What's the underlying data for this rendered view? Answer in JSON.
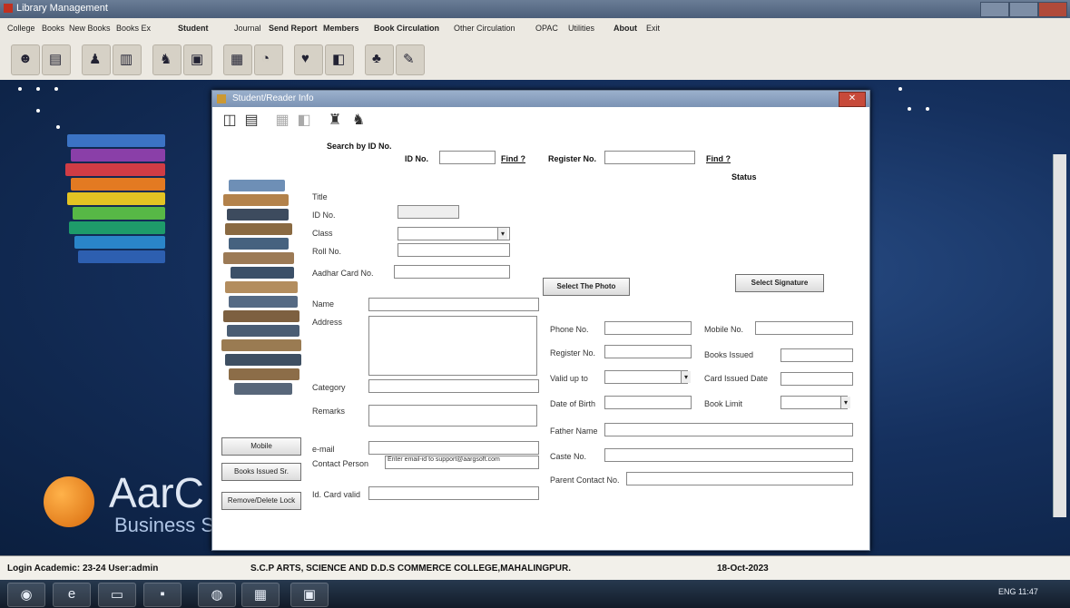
{
  "window": {
    "title": "Library Management"
  },
  "menubar": {
    "items": [
      {
        "label": "College",
        "bold": false
      },
      {
        "label": "Books",
        "bold": false
      },
      {
        "label": "New Books",
        "bold": false
      },
      {
        "label": "Books Ex",
        "bold": false
      },
      {
        "label": "Student",
        "bold": true
      },
      {
        "label": "Journal",
        "bold": false
      },
      {
        "label": "Send Report",
        "bold": true
      },
      {
        "label": "Members",
        "bold": true
      },
      {
        "label": "Book Circulation",
        "bold": true
      },
      {
        "label": "Other Circulation",
        "bold": false
      },
      {
        "label": "OPAC",
        "bold": false
      },
      {
        "label": "Utilities",
        "bold": false
      },
      {
        "label": "About",
        "bold": true
      },
      {
        "label": "Exit",
        "bold": false
      }
    ]
  },
  "toolbar": {
    "icons": [
      "person-icon",
      "monitor-icon",
      "user-icon",
      "books-icon",
      "reader-icon",
      "card-icon",
      "report-icon",
      "chart-icon",
      "people-icon",
      "shelf-icon",
      "tree-icon",
      "pen-icon"
    ]
  },
  "desktop": {
    "brand": "AarC",
    "brand_sub": "Business S"
  },
  "dialog": {
    "title": "Student/Reader Info",
    "close": "✕",
    "search_by": "Search by ID No.",
    "id_label": "ID No.",
    "id_value": "",
    "find1": "Find ?",
    "register_label": "Register No.",
    "register_value": "",
    "find2": "Find ?",
    "status_label": "Status",
    "fields_left": {
      "title": "Title",
      "id": "ID No.",
      "class": "Class",
      "roll": "Roll No.",
      "aadhar": "Aadhar Card No.",
      "name": "Name",
      "address": "Address",
      "category": "Category",
      "remarks": "Remarks",
      "email": "e-mail",
      "contact_person": "Contact Person",
      "cert": "Id. Card valid"
    },
    "email_value": "Enter email-id to support@aargsoft.com",
    "select_photo": "Select The Photo",
    "select_signature": "Select Signature",
    "fields_right": {
      "phone": "Phone No.",
      "reg_no": "Register No.",
      "valid_upto": "Valid up to",
      "date_of_birth": "Date of Birth",
      "mobile": "Mobile No.",
      "no_books": "Books Issued",
      "card_date": "Card Issued Date",
      "book_limit": "Book Limit",
      "mother": "Father Name",
      "caste": "Caste No.",
      "parent_contact": "Parent Contact No."
    },
    "side_buttons": [
      "Mobile",
      "Books Issued Sr.",
      "Remove/Delete Lock"
    ]
  },
  "statusbar": {
    "login": "Login Academic: 23-24  User:admin",
    "college": "S.C.P ARTS, SCIENCE AND D.D.S COMMERCE COLLEGE,MAHALINGPUR.",
    "date": "18-Oct-2023"
  },
  "taskbar": {
    "apps": [
      "start-icon",
      "edge-icon",
      "folder-icon",
      "terminal-icon",
      "chrome-icon",
      "app-icon",
      "app2-icon"
    ],
    "tray": "ENG  11:47"
  },
  "colors": {
    "accent": "#1a3c7a",
    "brand_orange": "#e0771a"
  }
}
